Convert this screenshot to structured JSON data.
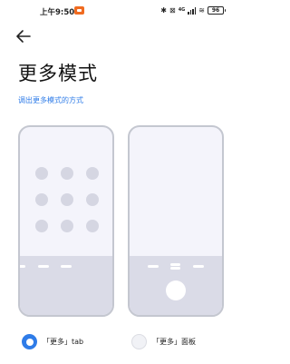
{
  "status_bar": {
    "time": "上午9:50",
    "battery": "96",
    "network_label": "4G"
  },
  "header": {
    "title": "更多模式",
    "subtitle": "调出更多模式的方式"
  },
  "options": [
    {
      "label": "「更多」tab",
      "selected": true
    },
    {
      "label": "「更多」面板",
      "selected": false
    }
  ],
  "colors": {
    "accent": "#2f7ce8",
    "card_border": "#c4c7d0",
    "card_top": "#f4f4fb",
    "card_bottom": "#dadbe7",
    "app_icon": "#d5d6e2"
  }
}
